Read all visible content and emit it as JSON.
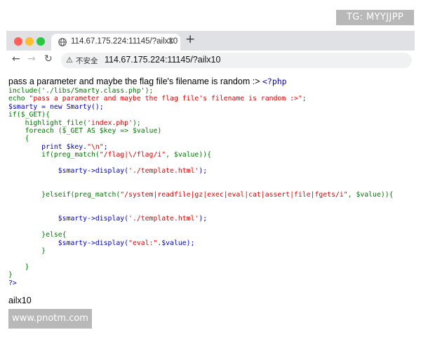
{
  "watermark_top": "TG: MYYJJPP",
  "watermark_bottom": "www.pnotm.com",
  "browser": {
    "tab_title": "114.67.175.224:11145/?ailx10",
    "tab_close": "×",
    "new_tab": "+",
    "nav_back": "←",
    "nav_forward": "→",
    "nav_reload": "↻",
    "security_icon": "warning-triangle",
    "security_label": "⚠",
    "security_text": "不安全",
    "url": "114.67.175.224:11145/?ailx10"
  },
  "page": {
    "lead_text": "pass a parameter and maybe the flag file's filename is random :>",
    "php_open_tag": "<?php",
    "code_lines": [
      [
        {
          "t": "include('./libs/Smarty.class.php');",
          "c": "def"
        }
      ],
      [
        {
          "t": "echo ",
          "c": "def"
        },
        {
          "t": "\"pass a parameter and maybe the flag file's filename is random :>\"",
          "c": "str"
        },
        {
          "t": ";",
          "c": "def"
        }
      ],
      [
        {
          "t": "$smarty = new Smarty();",
          "c": "kw"
        }
      ],
      [
        {
          "t": "if($_GET){",
          "c": "def"
        }
      ],
      [
        {
          "t": "    highlight_file(",
          "c": "def"
        },
        {
          "t": "'index.php'",
          "c": "str"
        },
        {
          "t": ");",
          "c": "def"
        }
      ],
      [
        {
          "t": "    foreach ($_GET AS $key => $value)",
          "c": "def"
        }
      ],
      [
        {
          "t": "    {",
          "c": "def"
        }
      ],
      [
        {
          "t": "        print $key.",
          "c": "kw"
        },
        {
          "t": "\"\\n\"",
          "c": "str"
        },
        {
          "t": ";",
          "c": "kw"
        }
      ],
      [
        {
          "t": "        if(preg_match(",
          "c": "def"
        },
        {
          "t": "\"/flag|\\/flag/i\"",
          "c": "str"
        },
        {
          "t": ", $value)){",
          "c": "def"
        }
      ],
      [],
      [
        {
          "t": "            $smarty->display(",
          "c": "kw"
        },
        {
          "t": "'./template.html'",
          "c": "str"
        },
        {
          "t": ");",
          "c": "kw"
        }
      ],
      [],
      [],
      [
        {
          "t": "        }elseif(preg_match(",
          "c": "def"
        },
        {
          "t": "\"/system|readfile|gz|exec|eval|cat|assert|file|fgets/i\"",
          "c": "str"
        },
        {
          "t": ", $value)){",
          "c": "def"
        }
      ],
      [],
      [],
      [
        {
          "t": "            $smarty->display(",
          "c": "kw"
        },
        {
          "t": "'./template.html'",
          "c": "str"
        },
        {
          "t": ");",
          "c": "kw"
        }
      ],
      [],
      [
        {
          "t": "        }else{",
          "c": "def"
        }
      ],
      [
        {
          "t": "            $smarty->display(",
          "c": "kw"
        },
        {
          "t": "\"eval:\"",
          "c": "str"
        },
        {
          "t": ".$value);",
          "c": "kw"
        }
      ],
      [
        {
          "t": "        }",
          "c": "def"
        }
      ],
      [],
      [
        {
          "t": "    }",
          "c": "def"
        }
      ],
      [
        {
          "t": "}",
          "c": "def"
        }
      ],
      [
        {
          "t": "?>",
          "c": "kw"
        }
      ]
    ],
    "output_text": "ailx10"
  },
  "colors": {
    "php_default": "#007700",
    "php_string": "#dd0000",
    "php_keyword": "#0000bb"
  }
}
